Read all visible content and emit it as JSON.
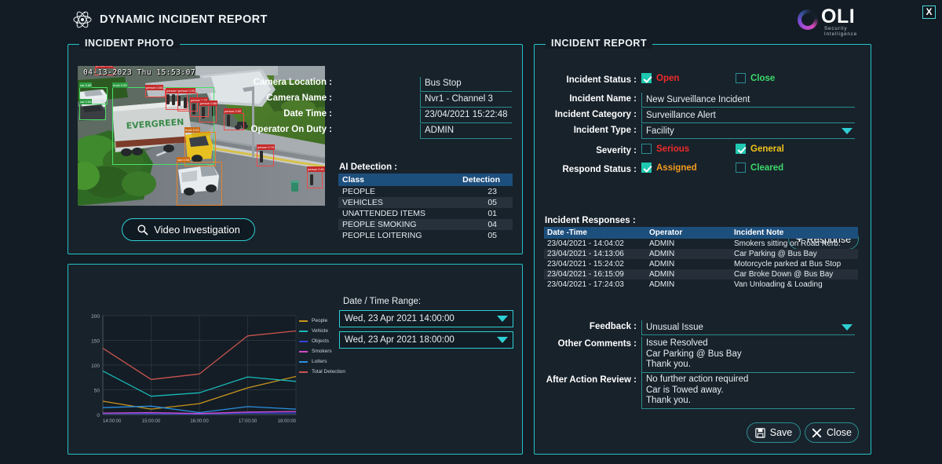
{
  "header": {
    "title": "DYNAMIC INCIDENT REPORT",
    "brand_name": "OLI",
    "brand_tagline": "Security Intelligence",
    "close_label": "X"
  },
  "photo_panel": {
    "title": "INCIDENT PHOTO",
    "video_timestamp": "04-13-2023 Thu 15:53:07",
    "video_button": "Video Investigation",
    "fields": [
      {
        "label": "Camera Location :",
        "value": "Bus Stop"
      },
      {
        "label": "Camera Name :",
        "value": "Nvr1 - Channel 3"
      },
      {
        "label": "Date Time :",
        "value": "23/04/2021 15:22:48"
      },
      {
        "label": "Operator On Duty :",
        "value": "ADMIN"
      }
    ],
    "ai_detection": {
      "title": "AI Detection :",
      "columns": [
        "Class",
        "Detection"
      ],
      "rows": [
        {
          "class": "PEOPLE",
          "detection": "23"
        },
        {
          "class": "VEHICLES",
          "detection": "05"
        },
        {
          "class": "UNATTENDED ITEMS",
          "detection": "01"
        },
        {
          "class": "PEOPLE SMOKING",
          "detection": "04"
        },
        {
          "class": "PEOPLE LOITERING",
          "detection": "05"
        }
      ]
    }
  },
  "chart_panel": {
    "range_title": "Date / Time Range:",
    "range_from": "Wed, 23 Apr 2021  14:00:00",
    "range_to": "Wed, 23 Apr 2021  18:00:00"
  },
  "chart_data": {
    "type": "line",
    "title": "",
    "xlabel": "",
    "ylabel": "",
    "x": [
      "14:00:00",
      "15:00:00",
      "16:00:00",
      "17:00:00",
      "18:00:00"
    ],
    "ylim": [
      0,
      200
    ],
    "yticks": [
      0,
      50,
      100,
      150,
      200
    ],
    "grid": true,
    "legend_position": "right",
    "series": [
      {
        "name": "People",
        "color": "#c8941e",
        "values": [
          27,
          11,
          22,
          54,
          77
        ]
      },
      {
        "name": "Vehicle",
        "color": "#18b8b8",
        "values": [
          88,
          37,
          44,
          76,
          67
        ]
      },
      {
        "name": "Objects",
        "color": "#3344dd",
        "values": [
          2,
          2,
          1,
          3,
          3
        ]
      },
      {
        "name": "Smokers",
        "color": "#d04bc8",
        "values": [
          3,
          4,
          2,
          5,
          6
        ]
      },
      {
        "name": "Loiters",
        "color": "#2a8fe0",
        "values": [
          14,
          17,
          4,
          16,
          11
        ]
      },
      {
        "name": "Total Detection",
        "color": "#c9544f",
        "values": [
          134,
          71,
          82,
          159,
          169
        ]
      }
    ]
  },
  "report_panel": {
    "title": "INCIDENT REPORT",
    "status_label": "Incident Status :",
    "status_open": {
      "label": "Open",
      "checked": true,
      "color": "#ef2b2b"
    },
    "status_close": {
      "label": "Close",
      "checked": false,
      "color": "#3dd96a"
    },
    "name_label": "Incident Name :",
    "name_value": "New Surveillance Incident",
    "category_label": "Incident Category :",
    "category_value": "Surveillance Alert",
    "type_label": "Incident Type :",
    "type_value": "Facility",
    "severity_label": "Severity :",
    "severity_serious": {
      "label": "Serious",
      "checked": false,
      "color": "#ef2b2b"
    },
    "severity_general": {
      "label": "General",
      "checked": true,
      "color": "#f0c419"
    },
    "respond_label": "Respond Status :",
    "respond_assigned": {
      "label": "Assigned",
      "checked": true,
      "color": "#f29c1f"
    },
    "respond_cleared": {
      "label": "Cleared",
      "checked": false,
      "color": "#3dd96a"
    },
    "response_button": "Response",
    "responses_title": "Incident Responses :",
    "responses_columns": [
      "Date -Time",
      "Operator",
      "Incident Note"
    ],
    "responses": [
      {
        "datetime": "23/04/2021 - 14:04:02",
        "operator": "ADMIN",
        "note": "Smokers sitting on Road Kerb."
      },
      {
        "datetime": "23/04/2021 - 14:13:06",
        "operator": "ADMIN",
        "note": "Car Parking @ Bus Bay"
      },
      {
        "datetime": "23/04/2021 - 15:24:02",
        "operator": "ADMIN",
        "note": "Motorcycle parked at Bus Stop"
      },
      {
        "datetime": "23/04/2021 - 16:15:09",
        "operator": "ADMIN",
        "note": "Car  Broke Down @ Bus Bay"
      },
      {
        "datetime": "23/04/2021 - 17:24:03",
        "operator": "ADMIN",
        "note": "Van Unloading & Loading"
      }
    ],
    "feedback_label": "Feedback :",
    "feedback_value": "Unusual Issue",
    "comments_label": "Other Comments :",
    "comments_value": "Issue Resolved\nCar Parking @ Bus Bay\nThank you.",
    "review_label": "After Action Review :",
    "review_value": "No further action required\nCar is Towed away.\nThank you.",
    "save_button": "Save",
    "close_button": "Close"
  }
}
